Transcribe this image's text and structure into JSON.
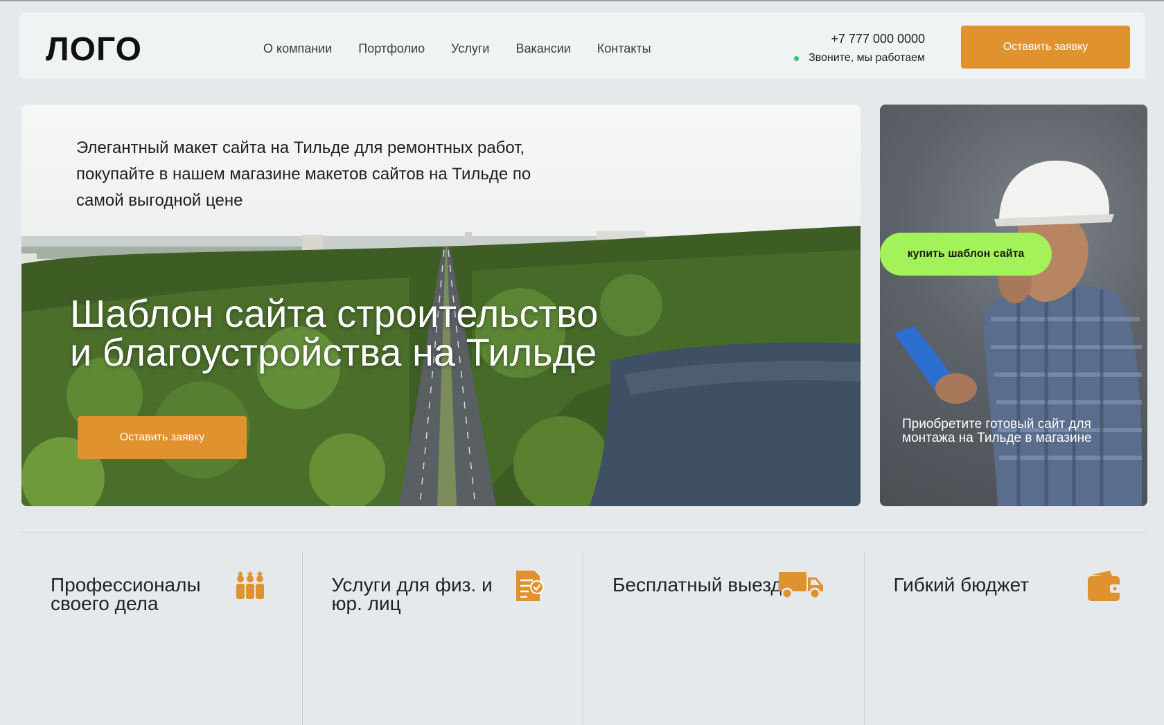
{
  "header": {
    "logo": "ЛОГО",
    "nav": [
      "О компании",
      "Портфолио",
      "Услуги",
      "Вакансии",
      "Контакты"
    ],
    "phone": "+7 777 000 0000",
    "status": "Звоните, мы работаем",
    "cta": "Оставить заявку"
  },
  "hero": {
    "intro": "Элегантный макет сайта на Тильде для ремонтных работ, покупайте в нашем магазине макетов сайтов на Тильде по самой выгодной цене",
    "title_line1": "Шаблон сайта строительство",
    "title_line2": "и благоустройства на Тильде",
    "cta": "Оставить заявку"
  },
  "side": {
    "badge": "купить шаблон сайта",
    "text": "Приобретите готовый сайт для монтажа на Тильде в магазине"
  },
  "features": [
    {
      "title": "Профессионалы своего дела",
      "icon": "team-icon"
    },
    {
      "title": "Услуги для физ. и юр. лиц",
      "icon": "document-check-icon"
    },
    {
      "title": "Бесплатный выезд",
      "icon": "truck-icon"
    },
    {
      "title": "Гибкий бюджет",
      "icon": "wallet-icon"
    }
  ],
  "colors": {
    "accent": "#e0922f",
    "badge": "#a4f25a",
    "status_dot": "#3ec46d",
    "background": "#e5e9ec"
  }
}
